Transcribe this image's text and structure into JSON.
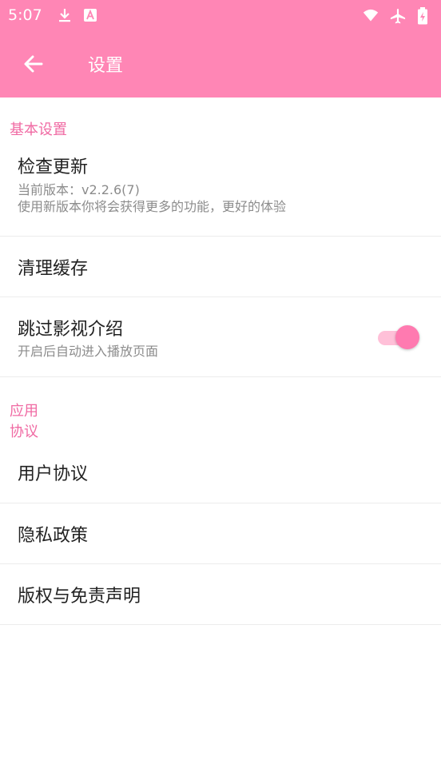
{
  "status_bar": {
    "time": "5:07",
    "icons": [
      "download-icon",
      "text-icon",
      "wifi-icon",
      "airplane-icon",
      "battery-icon"
    ]
  },
  "app_bar": {
    "title": "设置",
    "back_icon": "arrow-left-icon"
  },
  "sections": {
    "basic": {
      "header": "基本设置",
      "check_update": {
        "title": "检查更新",
        "version": "当前版本：v2.2.6(7)",
        "desc": "使用新版本你将会获得更多的功能，更好的体验"
      },
      "clear_cache": {
        "title": "清理缓存"
      },
      "skip_intro": {
        "title": "跳过影视介绍",
        "desc": "开启后自动进入播放页面",
        "enabled": true
      }
    },
    "app": {
      "header": "应用"
    },
    "agreement": {
      "header": "协议",
      "user_agreement": {
        "title": "用户协议"
      },
      "privacy_policy": {
        "title": "隐私政策"
      },
      "copyright": {
        "title": "版权与免责声明"
      }
    }
  },
  "colors": {
    "accent": "#ff86b5",
    "section_header": "#f06aa3",
    "toggle_thumb": "#ff7ab0",
    "toggle_track": "#ffc0d8"
  }
}
